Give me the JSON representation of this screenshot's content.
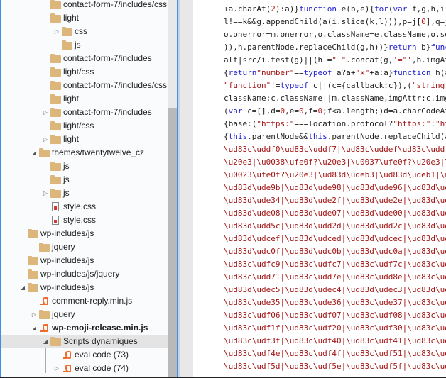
{
  "tree": {
    "rows": [
      {
        "depth": 3,
        "icon": "folder",
        "label": "contact-form-7/includes/css",
        "arrow": "none"
      },
      {
        "depth": 3,
        "icon": "folder",
        "label": "light",
        "arrow": "none"
      },
      {
        "depth": 4,
        "icon": "folder",
        "label": "css",
        "arrow": "collapsed"
      },
      {
        "depth": 4,
        "icon": "folder",
        "label": "js",
        "arrow": "none"
      },
      {
        "depth": 3,
        "icon": "folder",
        "label": "contact-form-7/includes",
        "arrow": "none"
      },
      {
        "depth": 3,
        "icon": "folder",
        "label": "light/css",
        "arrow": "none"
      },
      {
        "depth": 3,
        "icon": "folder",
        "label": "contact-form-7/includes/css",
        "arrow": "none"
      },
      {
        "depth": 3,
        "icon": "folder",
        "label": "light",
        "arrow": "none"
      },
      {
        "depth": 3,
        "icon": "folder",
        "label": "contact-form-7/includes",
        "arrow": "collapsed"
      },
      {
        "depth": 3,
        "icon": "folder",
        "label": "light/css",
        "arrow": "none"
      },
      {
        "depth": 3,
        "icon": "folder",
        "label": "light",
        "arrow": "collapsed"
      },
      {
        "depth": 2,
        "icon": "folder",
        "label": "themes/twentytwelve_cz",
        "arrow": "expanded"
      },
      {
        "depth": 3,
        "icon": "folder",
        "label": "js",
        "arrow": "none"
      },
      {
        "depth": 3,
        "icon": "folder",
        "label": "js",
        "arrow": "none"
      },
      {
        "depth": 3,
        "icon": "folder",
        "label": "js",
        "arrow": "collapsed"
      },
      {
        "depth": 3,
        "icon": "css-file",
        "label": "style.css",
        "arrow": "none"
      },
      {
        "depth": 3,
        "icon": "css-file",
        "label": "style.css",
        "arrow": "none"
      },
      {
        "depth": 1,
        "icon": "folder",
        "label": "wp-includes/js",
        "arrow": "none"
      },
      {
        "depth": 2,
        "icon": "folder",
        "label": "jquery",
        "arrow": "none"
      },
      {
        "depth": 1,
        "icon": "folder",
        "label": "wp-includes/js",
        "arrow": "none"
      },
      {
        "depth": 1,
        "icon": "folder",
        "label": "wp-includes/js/jquery",
        "arrow": "none"
      },
      {
        "depth": 1,
        "icon": "folder",
        "label": "wp-includes/js",
        "arrow": "expanded"
      },
      {
        "depth": 2,
        "icon": "script",
        "label": "comment-reply.min.js",
        "arrow": "none"
      },
      {
        "depth": 2,
        "icon": "folder",
        "label": "jquery",
        "arrow": "collapsed"
      },
      {
        "depth": 2,
        "icon": "script",
        "label": "wp-emoji-release.min.js",
        "arrow": "expanded",
        "bold": true
      },
      {
        "depth": 3,
        "icon": "folder",
        "label": "Scripts dynamiques",
        "arrow": "expanded",
        "selected": true
      },
      {
        "depth": 4,
        "icon": "script",
        "label": "eval code (73)",
        "arrow": "none"
      },
      {
        "depth": 4,
        "icon": "script",
        "label": "eval code (74)",
        "arrow": "collapsed"
      }
    ]
  },
  "code": {
    "lines": [
      [
        [
          "p",
          "+a.charAt("
        ],
        [
          "n",
          "2"
        ],
        [
          "p",
          "):a)}"
        ],
        [
          "k",
          "function"
        ],
        [
          "p",
          " e(b,e){"
        ],
        [
          "k",
          "for"
        ],
        [
          "p",
          "("
        ],
        [
          "k",
          "var"
        ],
        [
          "p",
          " f,g,h,i,"
        ]
      ],
      [
        [
          "p",
          "l!==k&&g.appendChild(a(i.slice(k,l))),p=j["
        ],
        [
          "n",
          "0"
        ],
        [
          "p",
          "],q=j"
        ]
      ],
      [
        [
          "p",
          "o.onerror=m.onerror,o.className=e.className,o.se"
        ]
      ],
      [
        [
          "p",
          ")),h.parentNode.replaceChild(g,h))}"
        ],
        [
          "k",
          "return"
        ],
        [
          "p",
          " b}"
        ],
        [
          "k",
          "func"
        ]
      ],
      [
        [
          "p",
          "alt|src/i.test(g)||(h+="
        ],
        [
          "s",
          "\" \""
        ],
        [
          "p",
          ".concat(g,"
        ],
        [
          "s",
          "'=\"'"
        ],
        [
          "p",
          ",b.imgAt"
        ]
      ],
      [
        [
          "p",
          "{"
        ],
        [
          "k",
          "return"
        ],
        [
          "s",
          "\"number\""
        ],
        [
          "p",
          "=="
        ],
        [
          "k",
          "typeof"
        ],
        [
          "p",
          " a?a+"
        ],
        [
          "s",
          "\"x\""
        ],
        [
          "p",
          "+a:a}"
        ],
        [
          "k",
          "function"
        ],
        [
          "p",
          " h(a"
        ]
      ],
      [
        [
          "s",
          "\"function\""
        ],
        [
          "p",
          "!="
        ],
        [
          "k",
          "typeof"
        ],
        [
          "p",
          " c||(c={callback:c}),("
        ],
        [
          "s",
          "\"string\""
        ]
      ],
      [
        [
          "p",
          "className:c.className||m.className,imgAttr:c.img"
        ]
      ],
      [
        [
          "p",
          "("
        ],
        [
          "k",
          "var"
        ],
        [
          "p",
          " c=[],d="
        ],
        [
          "n",
          "0"
        ],
        [
          "p",
          ",e="
        ],
        [
          "n",
          "0"
        ],
        [
          "p",
          ",f="
        ],
        [
          "n",
          "0"
        ],
        [
          "p",
          ";f<a.length;)d=a.charCodeAt"
        ]
      ],
      [
        [
          "p",
          "{base:("
        ],
        [
          "s",
          "\"https:\""
        ],
        [
          "p",
          "===location.protocol?"
        ],
        [
          "s",
          "\"https:\""
        ],
        [
          "p",
          ":"
        ],
        [
          "s",
          "\"ht"
        ]
      ],
      [
        [
          "p",
          "{"
        ],
        [
          "k",
          "this"
        ],
        [
          "p",
          ".parentNode&&"
        ],
        [
          "k",
          "this"
        ],
        [
          "p",
          ".parentNode.replaceChild(a"
        ]
      ],
      [
        [
          "s",
          "\\ud83c\\uddf0\\ud83c\\uddf7|\\ud83c\\uddef\\ud83c\\uddf"
        ]
      ],
      [
        [
          "s",
          "\\u20e3|\\u0038\\ufe0f?\\u20e3|\\u0037\\ufe0f?\\u20e3|\\"
        ]
      ],
      [
        [
          "s",
          "\\u0023\\ufe0f?\\u20e3|\\ud83d\\udeb3|\\ud83d\\udeb1|\\u"
        ]
      ],
      [
        [
          "s",
          "\\ud83d\\ude9b|\\ud83d\\ude98|\\ud83d\\ude96|\\ud83d\\ud"
        ]
      ],
      [
        [
          "s",
          "\\ud83d\\ude34|\\ud83d\\ude2f|\\ud83d\\ude2e|\\ud83d\\ud"
        ]
      ],
      [
        [
          "s",
          "\\ud83d\\ude08|\\ud83d\\ude07|\\ud83d\\ude00|\\ud83d\\ud"
        ]
      ],
      [
        [
          "s",
          "\\ud83d\\udd5c|\\ud83d\\udd2d|\\ud83d\\udd2c|\\ud83d\\ud"
        ]
      ],
      [
        [
          "s",
          "\\ud83d\\udcef|\\ud83d\\udced|\\ud83d\\udcec|\\ud83d\\ud"
        ]
      ],
      [
        [
          "s",
          "\\ud83d\\udc0f|\\ud83d\\udc0b|\\ud83d\\udc0a|\\ud83d\\ud"
        ]
      ],
      [
        [
          "s",
          "\\ud83c\\udfc9|\\ud83c\\udfc7|\\ud83c\\udf7c|\\ud83c\\ud"
        ]
      ],
      [
        [
          "s",
          "\\ud83c\\udd71|\\ud83c\\udd7e|\\ud83c\\udd8e|\\ud83c\\ud"
        ]
      ],
      [
        [
          "s",
          "\\ud83d\\udec5|\\ud83d\\udec4|\\ud83d\\udec3|\\ud83d\\ud"
        ]
      ],
      [
        [
          "s",
          "\\ud83c\\ude35|\\ud83c\\ude36|\\ud83c\\ude37|\\ud83c\\ud"
        ]
      ],
      [
        [
          "s",
          "\\ud83c\\udf06|\\ud83c\\udf07|\\ud83c\\udf08|\\ud83c\\ud"
        ]
      ],
      [
        [
          "s",
          "\\ud83c\\udf1f|\\ud83c\\udf20|\\ud83c\\udf30|\\ud83c\\ud"
        ]
      ],
      [
        [
          "s",
          "\\ud83c\\udf3f|\\ud83c\\udf40|\\ud83c\\udf41|\\ud83c\\ud"
        ]
      ],
      [
        [
          "s",
          "\\ud83c\\udf4e|\\ud83c\\udf4f|\\ud83c\\udf51|\\ud83c\\ud"
        ]
      ],
      [
        [
          "s",
          "\\ud83c\\udf5d|\\ud83c\\udf5e|\\ud83c\\udf5f|\\ud83c\\ud"
        ]
      ]
    ]
  },
  "colors": {
    "keyword": "#1f1fd0",
    "string": "#a31515",
    "folder": "#dcb67a",
    "script": "#f06a2a",
    "accent": "#3c8fe6"
  }
}
